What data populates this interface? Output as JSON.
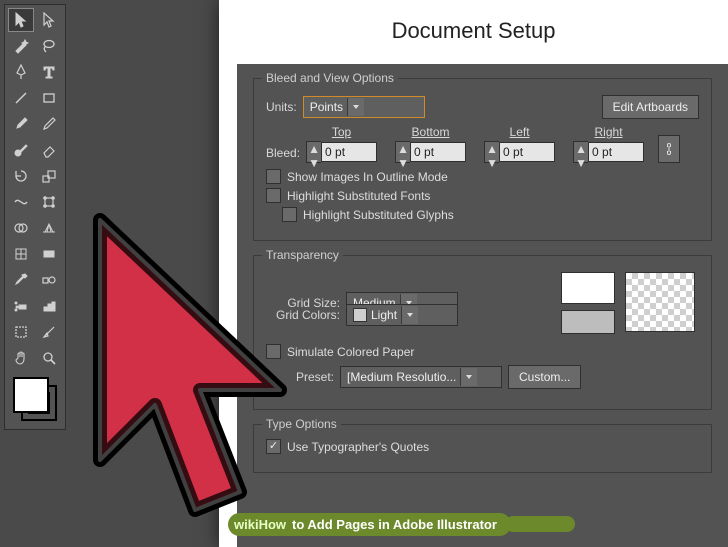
{
  "tools": {
    "rows": [
      [
        "selection",
        "direct-selection"
      ],
      [
        "magic-wand",
        "lasso"
      ],
      [
        "pen",
        "type"
      ],
      [
        "line-segment",
        "rectangle"
      ],
      [
        "paintbrush",
        "pencil"
      ],
      [
        "blob-brush",
        "eraser"
      ],
      [
        "rotate",
        "scale"
      ],
      [
        "width",
        "free-transform"
      ],
      [
        "shape-builder",
        "perspective-grid"
      ],
      [
        "mesh",
        "gradient"
      ],
      [
        "eyedropper",
        "blend"
      ],
      [
        "symbol-sprayer",
        "column-graph"
      ],
      [
        "artboard",
        "slice"
      ],
      [
        "hand",
        "zoom"
      ]
    ],
    "selected": "selection"
  },
  "dialog": {
    "title": "Document Setup",
    "bleed_view": {
      "title": "Bleed and View Options",
      "units_label": "Units:",
      "units_value": "Points",
      "edit_artboards": "Edit Artboards",
      "bleed_label": "Bleed:",
      "columns": [
        "Top",
        "Bottom",
        "Left",
        "Right"
      ],
      "values": [
        "0 pt",
        "0 pt",
        "0 pt",
        "0 pt"
      ],
      "show_images": "Show Images In Outline Mode",
      "hl_fonts": "Highlight Substituted Fonts",
      "hl_glyphs": "Highlight Substituted Glyphs"
    },
    "transparency": {
      "title": "Transparency",
      "grid_size_label": "Grid Size:",
      "grid_size_value": "Medium",
      "grid_colors_label": "Grid Colors:",
      "grid_colors_value": "Light",
      "simulate": "Simulate Colored Paper",
      "preset_label": "Preset:",
      "preset_value": "[Medium Resolutio...",
      "custom": "Custom..."
    },
    "type_options": {
      "title": "Type Options",
      "typographers": "Use Typographer's Quotes"
    }
  },
  "watermark": {
    "logo": "wikiHow",
    "text": " to Add Pages in Adobe Illustrator"
  }
}
